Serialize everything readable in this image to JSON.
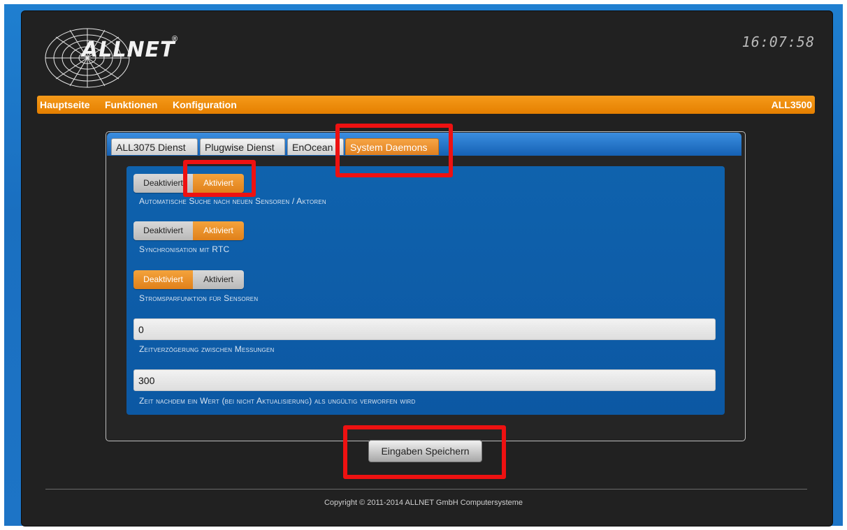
{
  "header": {
    "brand": "ALLNET",
    "brand_mark": "®",
    "clock": "16:07:58"
  },
  "nav": {
    "items": [
      "Hauptseite",
      "Funktionen",
      "Konfiguration"
    ],
    "device": "ALL3500"
  },
  "tabs": [
    {
      "label": "ALL3075 Dienst",
      "active": false
    },
    {
      "label": "Plugwise Dienst",
      "active": false
    },
    {
      "label": "EnOcean",
      "active": false
    },
    {
      "label": "System Daemons",
      "active": true
    }
  ],
  "settings": [
    {
      "type": "toggle",
      "off_label": "Deaktiviert",
      "on_label": "Aktiviert",
      "selected": "Aktiviert",
      "label": "Automatische Suche nach neuen Sensoren / Aktoren"
    },
    {
      "type": "toggle",
      "off_label": "Deaktiviert",
      "on_label": "Aktiviert",
      "selected": "Aktiviert",
      "label": "Synchronisation mit RTC"
    },
    {
      "type": "toggle",
      "off_label": "Deaktiviert",
      "on_label": "Aktiviert",
      "selected": "Deaktiviert",
      "label": "Stromsparfunktion für Sensoren"
    },
    {
      "type": "input",
      "value": "0",
      "label": "Zeitverzögerung zwischen Messungen"
    },
    {
      "type": "input",
      "value": "300",
      "label": "Zeit nachdem ein Wert (bei nicht Aktualisierung) als ungültig verworfen wird"
    }
  ],
  "save_button": "Eingaben Speichern",
  "footer": {
    "copyright": "Copyright © 2011-2014 ALLNET GmbH Computersysteme"
  },
  "colors": {
    "accent": "#e57f00",
    "highlight": "#ee1111",
    "panel": "#212121",
    "blue": "#0f62ad"
  }
}
